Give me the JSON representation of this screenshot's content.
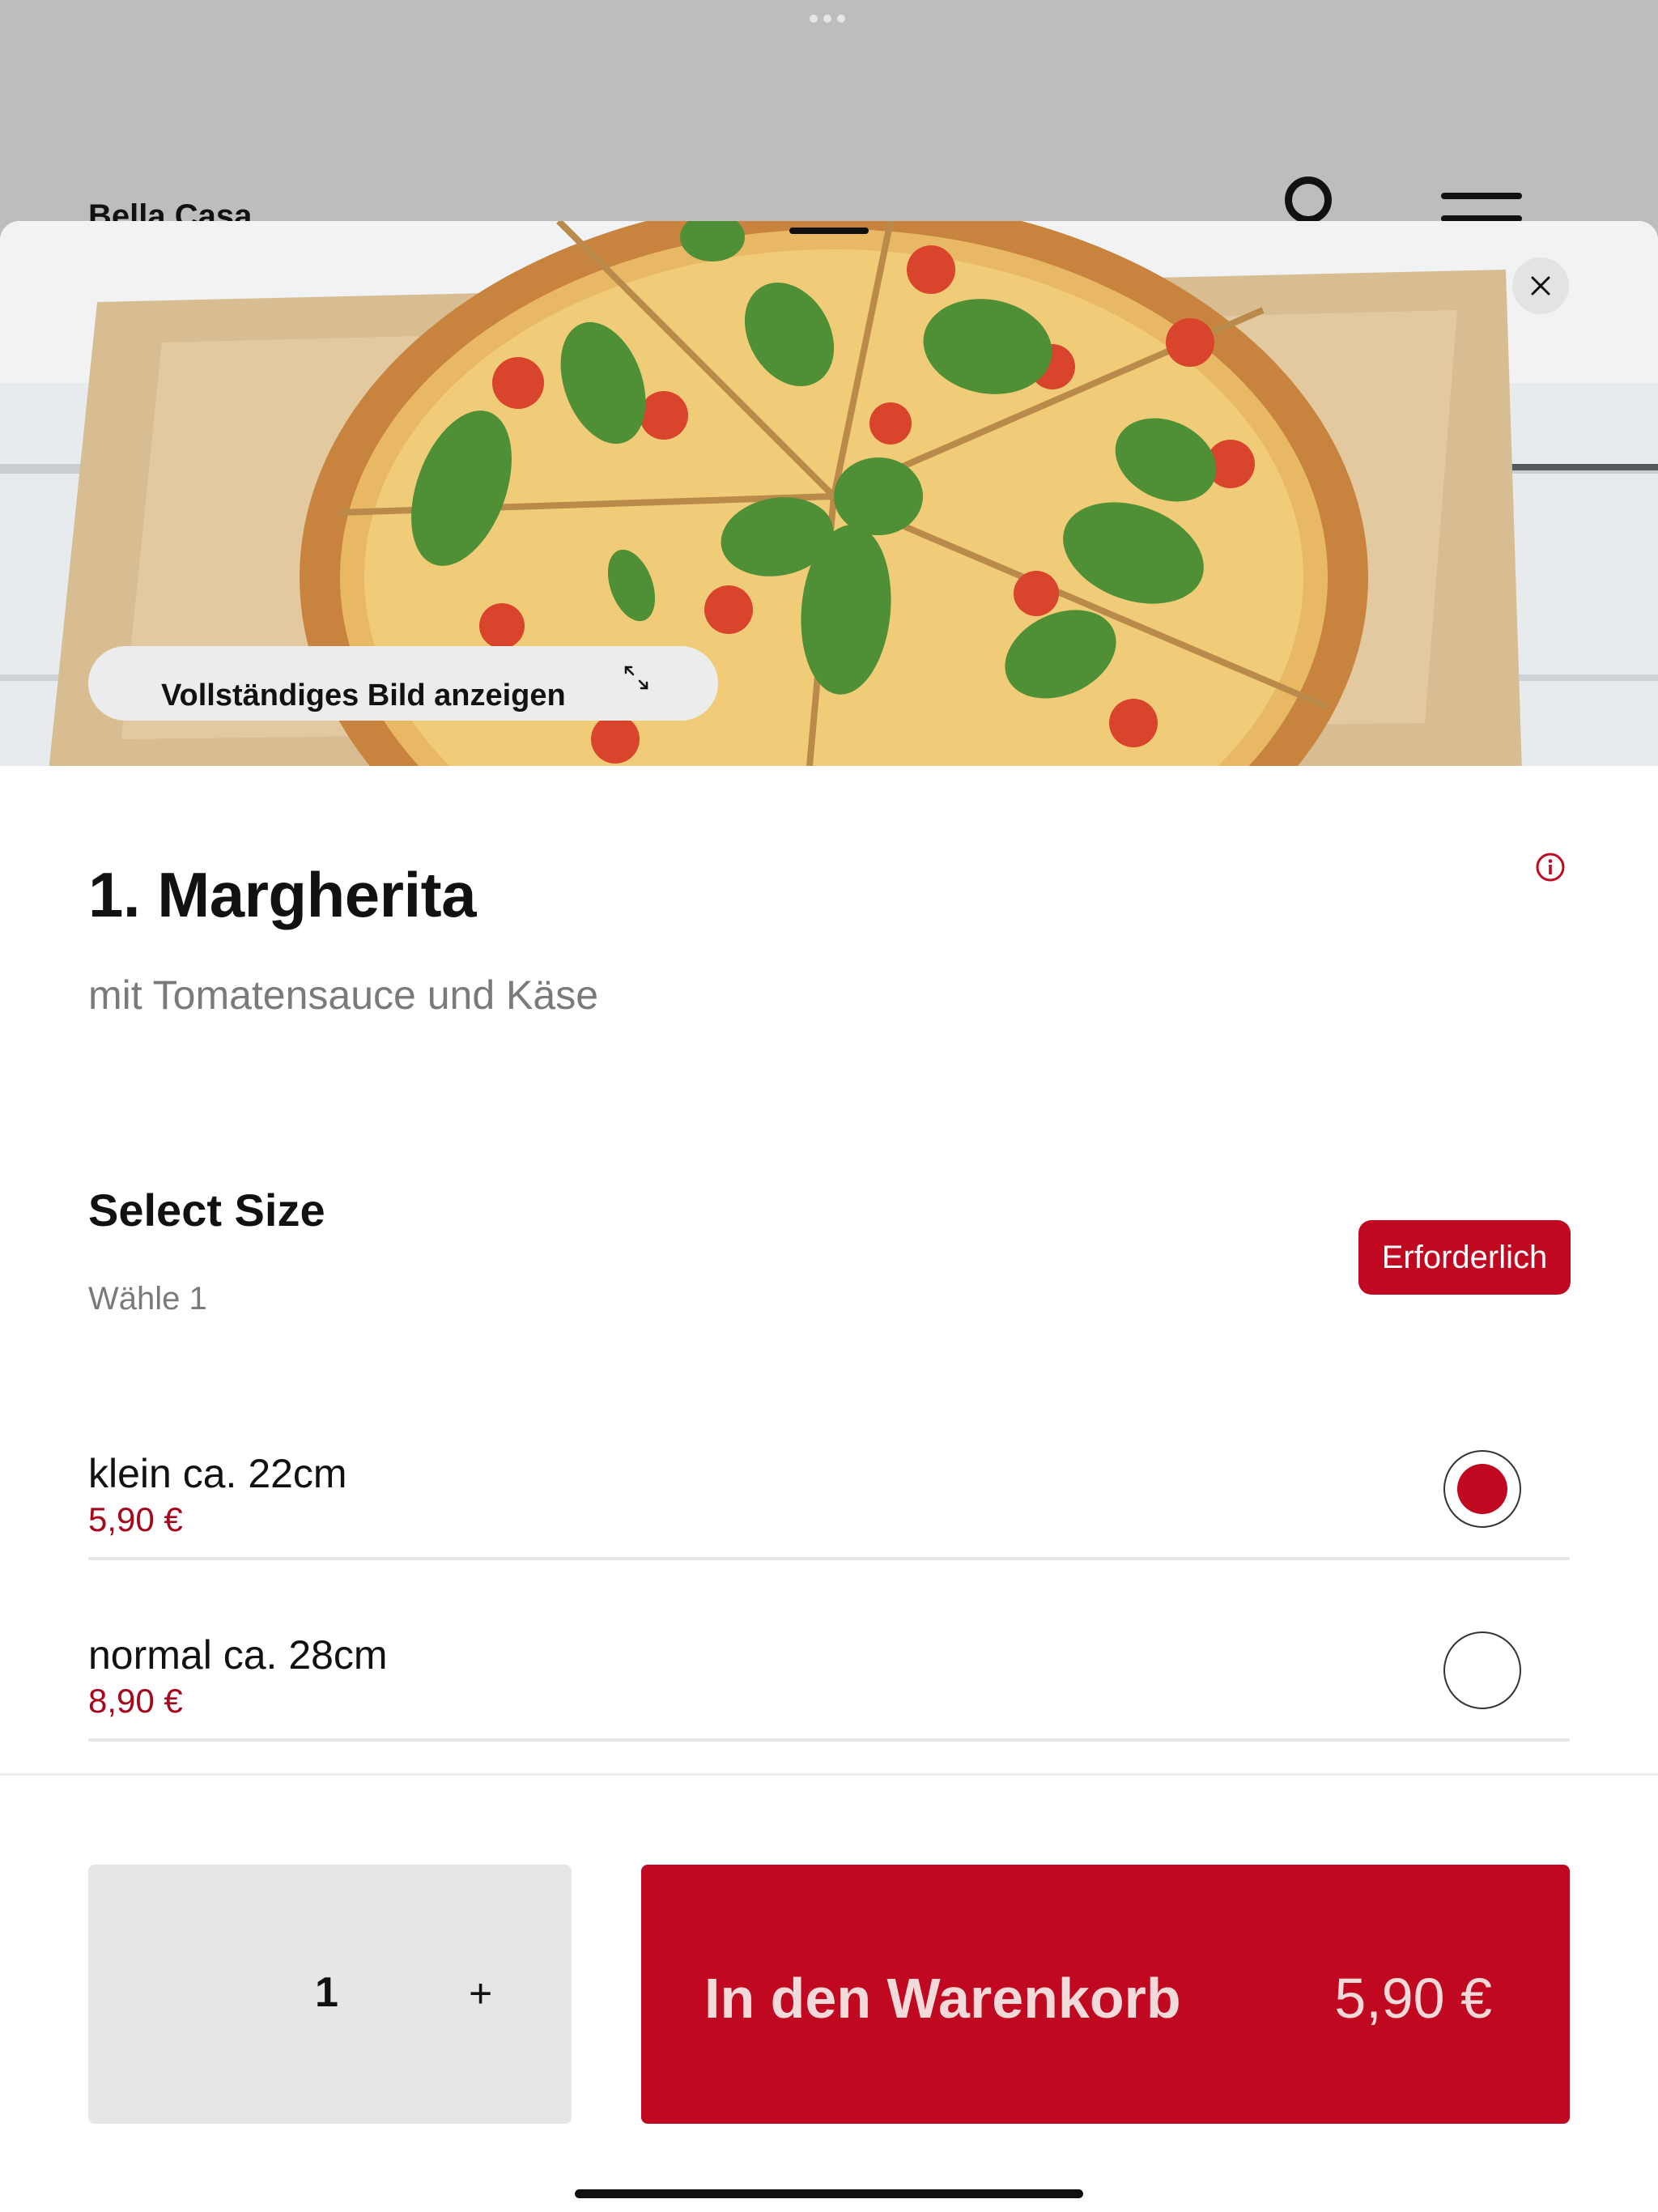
{
  "background_app": {
    "brand": "Bella Casa",
    "user_icon": "user-circle-icon",
    "menu_icon": "hamburger-menu-icon"
  },
  "hero": {
    "full_image_label": "Vollständiges Bild anzeigen",
    "close_icon": "close-icon",
    "expand_icon": "expand-arrows-icon"
  },
  "product": {
    "title": "1. Margherita",
    "description": "mit Tomatensauce und Käse",
    "info_icon": "info-icon"
  },
  "size_section": {
    "title": "Select Size",
    "hint": "Wähle 1",
    "required_label": "Erforderlich",
    "options": [
      {
        "name": "klein ca. 22cm",
        "price": "5,90 €",
        "selected": true
      },
      {
        "name": "normal ca. 28cm",
        "price": "8,90 €",
        "selected": false
      }
    ]
  },
  "footer": {
    "quantity": "1",
    "plus_label": "+",
    "add_to_cart_label": "In den Warenkorb",
    "total_price": "5,90 €"
  },
  "colors": {
    "accent": "#c00920",
    "price": "#a5081d",
    "muted_text": "#7a7a7a"
  }
}
